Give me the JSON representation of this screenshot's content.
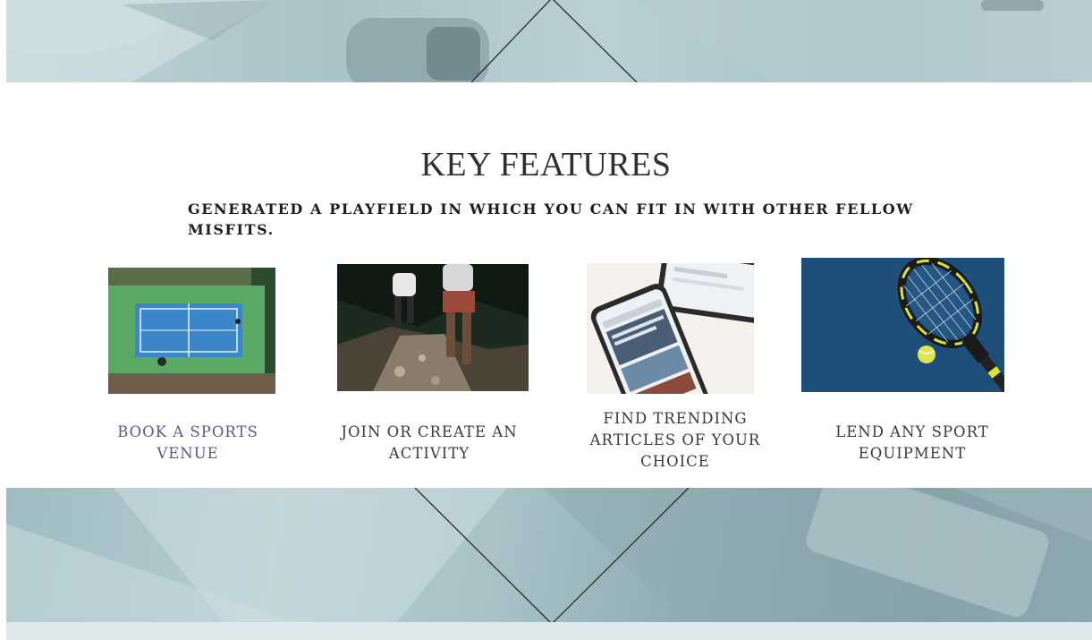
{
  "heading": "KEY FEATURES",
  "subheading": "GENERATED A PLAYFIELD IN WHICH YOU CAN FIT IN WITH OTHER FELLOW MISFITS.",
  "features": [
    {
      "label": "BOOK A SPORTS VENUE",
      "image_icon": "tennis-court-aerial-icon"
    },
    {
      "label": "JOIN OR CREATE AN ACTIVITY",
      "image_icon": "trail-runners-icon"
    },
    {
      "label": "FIND TRENDING ARTICLES OF YOUR CHOICE",
      "image_icon": "phone-articles-icon"
    },
    {
      "label": "LEND ANY SPORT EQUIPMENT",
      "image_icon": "tennis-racket-icon"
    }
  ],
  "colors": {
    "heading": "#2f2f2f",
    "accent_label": "#5a5a86",
    "band": "#a9c2c8"
  }
}
